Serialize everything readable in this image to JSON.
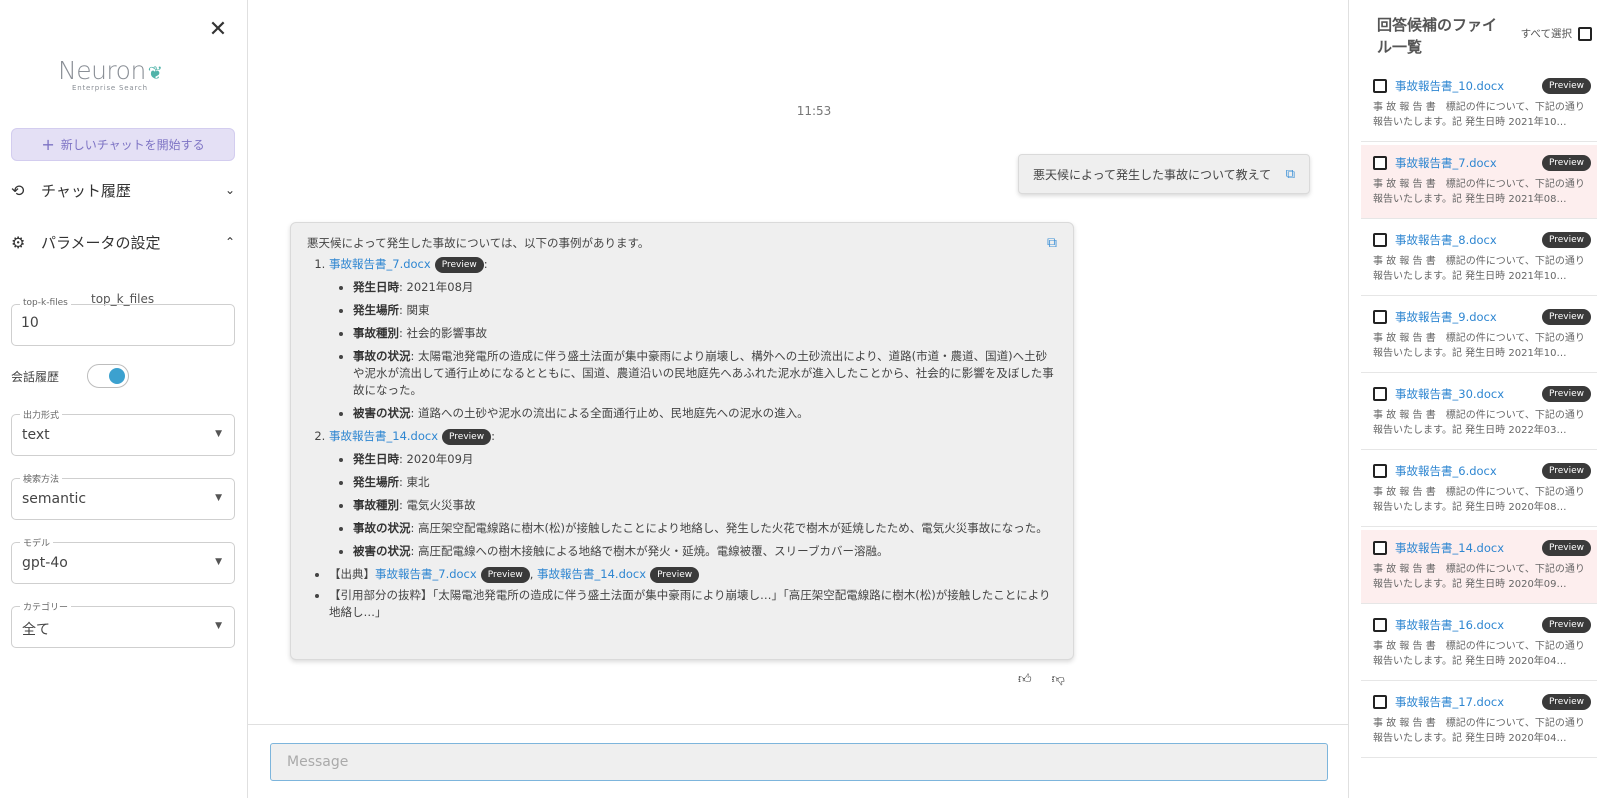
{
  "sidebar": {
    "logo_text": "Neuron",
    "logo_sub": "Enterprise Search",
    "new_chat": "新しいチャットを開始する",
    "chat_history": "チャット履歴",
    "params": "パラメータの設定",
    "topk_caption": "top_k_files",
    "topk_legend": "top-k-files",
    "topk_value": "10",
    "history_label": "会話履歴",
    "output_legend": "出力形式",
    "output_value": "text",
    "search_legend": "検索方法",
    "search_value": "semantic",
    "model_legend": "モデル",
    "model_value": "gpt-4o",
    "category_legend": "カテゴリー",
    "category_value": "全て"
  },
  "chat": {
    "timestamp": "11:53",
    "user_message": "悪天候によって発生した事故について教えて",
    "bot": {
      "intro": "悪天候によって発生した事故については、以下の事例があります。",
      "preview_label": "Preview",
      "items": [
        {
          "file": "事故報告書_7.docx",
          "details": [
            {
              "label": "発生日時",
              "text": ": 2021年08月"
            },
            {
              "label": "発生場所",
              "text": ": 関東"
            },
            {
              "label": "事故種別",
              "text": ": 社会的影響事故"
            },
            {
              "label": "事故の状況",
              "text": ": 太陽電池発電所の造成に伴う盛土法面が集中豪雨により崩壊し、構外への土砂流出により、道路(市道・農道、国道)へ土砂や泥水が流出して通行止めになるとともに、国道、農道沿いの民地庭先へあふれた泥水が進入したことから、社会的に影響を及ぼした事故になった。"
            },
            {
              "label": "被害の状況",
              "text": ": 道路への土砂や泥水の流出による全面通行止め、民地庭先への泥水の進入。"
            }
          ]
        },
        {
          "file": "事故報告書_14.docx",
          "details": [
            {
              "label": "発生日時",
              "text": ": 2020年09月"
            },
            {
              "label": "発生場所",
              "text": ": 東北"
            },
            {
              "label": "事故種別",
              "text": ": 電気火災事故"
            },
            {
              "label": "事故の状況",
              "text": ": 高圧架空配電線路に樹木(松)が接触したことにより地絡し、発生した火花で樹木が延焼したため、電気火災事故になった。"
            },
            {
              "label": "被害の状況",
              "text": ": 高圧配電線への樹木接触による地絡で樹木が発火・延焼。電線被覆、スリーブカバー溶融。"
            }
          ]
        }
      ],
      "source_prefix": "【出典】",
      "source_files": [
        "事故報告書_7.docx",
        "事故報告書_14.docx"
      ],
      "quote": "【引用部分の抜粋】「太陽電池発電所の造成に伴う盛土法面が集中豪雨により崩壊し…」「高圧架空配電線路に樹木(松)が接触したことにより地絡し…」"
    },
    "input_placeholder": "Message"
  },
  "files_panel": {
    "title": "回答候補のファイル一覧",
    "select_all": "すべて選択",
    "preview_label": "Preview",
    "files": [
      {
        "name": "事故報告書_10.docx",
        "snippet": "事 故 報 告 書　標記の件について、下記の通り報告いたします。記 発生日時 2021年10…",
        "highlight": false
      },
      {
        "name": "事故報告書_7.docx",
        "snippet": "事 故 報 告 書　標記の件について、下記の通り報告いたします。記 発生日時 2021年08…",
        "highlight": true
      },
      {
        "name": "事故報告書_8.docx",
        "snippet": "事 故 報 告 書　標記の件について、下記の通り報告いたします。記 発生日時 2021年10…",
        "highlight": false
      },
      {
        "name": "事故報告書_9.docx",
        "snippet": "事 故 報 告 書　標記の件について、下記の通り報告いたします。記 発生日時 2021年10…",
        "highlight": false
      },
      {
        "name": "事故報告書_30.docx",
        "snippet": "事 故 報 告 書　標記の件について、下記の通り報告いたします。記 発生日時 2022年03…",
        "highlight": false
      },
      {
        "name": "事故報告書_6.docx",
        "snippet": "事 故 報 告 書　標記の件について、下記の通り報告いたします。記 発生日時 2020年08…",
        "highlight": false
      },
      {
        "name": "事故報告書_14.docx",
        "snippet": "事 故 報 告 書　標記の件について、下記の通り報告いたします。記 発生日時 2020年09…",
        "highlight": true
      },
      {
        "name": "事故報告書_16.docx",
        "snippet": "事 故 報 告 書　標記の件について、下記の通り報告いたします。記 発生日時 2020年04…",
        "highlight": false
      },
      {
        "name": "事故報告書_17.docx",
        "snippet": "事 故 報 告 書　標記の件について、下記の通り報告いたします。記 発生日時 2020年04…",
        "highlight": false
      }
    ]
  }
}
